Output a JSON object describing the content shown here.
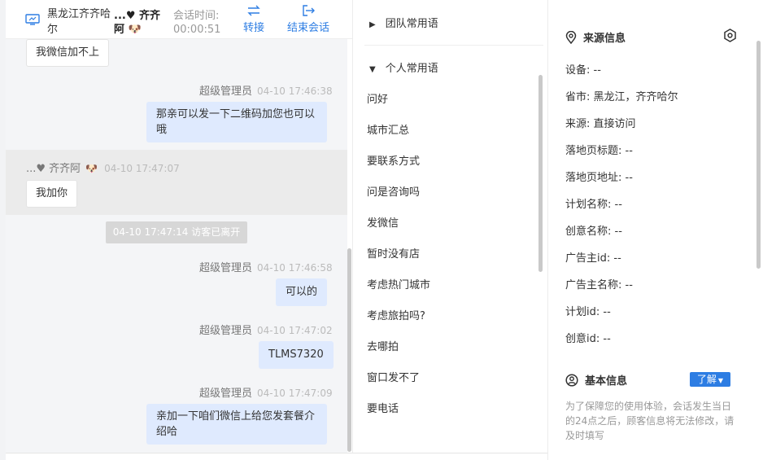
{
  "header": {
    "location": "黑龙江齐齐哈尔",
    "visitor_name": "...♥ 齐齐阿",
    "time_label": "会话时间:",
    "time_value": "00:00:51",
    "transfer_label": "转接",
    "end_label": "结束会话"
  },
  "chat": {
    "messages": [
      {
        "side": "left",
        "text": "我微信加不上"
      },
      {
        "side": "right",
        "sender": "超级管理员",
        "time": "04-10 17:46:38",
        "text": "那亲可以发一下二维码加您也可以哦"
      },
      {
        "side": "left",
        "sender": "...♥ 齐齐阿",
        "time": "04-10 17:47:07",
        "text": "我加你"
      },
      {
        "side": "system",
        "text": "04-10 17:47:14 访客已离开"
      },
      {
        "side": "right",
        "sender": "超级管理员",
        "time": "04-10 17:46:58",
        "text": "可以的"
      },
      {
        "side": "right",
        "sender": "超级管理员",
        "time": "04-10 17:47:02",
        "text": "TLMS7320"
      },
      {
        "side": "right",
        "sender": "超级管理员",
        "time": "04-10 17:47:09",
        "text": "亲加一下咱们微信上给您发套餐介绍哈"
      }
    ]
  },
  "phrases": {
    "team_label": "团队常用语",
    "personal_label": "个人常用语",
    "items": [
      "问好",
      "城市汇总",
      "要联系方式",
      "问是咨询吗",
      "发微信",
      "暂时没有店",
      "考虑热门城市",
      "考虑旅拍吗?",
      "去哪拍",
      "窗口发不了",
      "要电话"
    ]
  },
  "source_info": {
    "title": "来源信息",
    "fields": [
      "设备: --",
      "省市: 黑龙江，齐齐哈尔",
      "来源: 直接访问",
      "落地页标题: --",
      "落地页地址: --",
      "计划名称: --",
      "创意名称: --",
      "广告主id: --",
      "广告主名称: --",
      "计划id: --",
      "创意id: --"
    ]
  },
  "basic_info": {
    "title": "基本信息",
    "learn_more": "了解",
    "notice": "为了保障您的使用体验，会话发生当日的24点之后，顾客信息将无法修改，请及时填写"
  },
  "colors": {
    "accent": "#2d7de3",
    "bubble_right": "#dfeafe",
    "chat_bg": "#f4f5f7"
  }
}
